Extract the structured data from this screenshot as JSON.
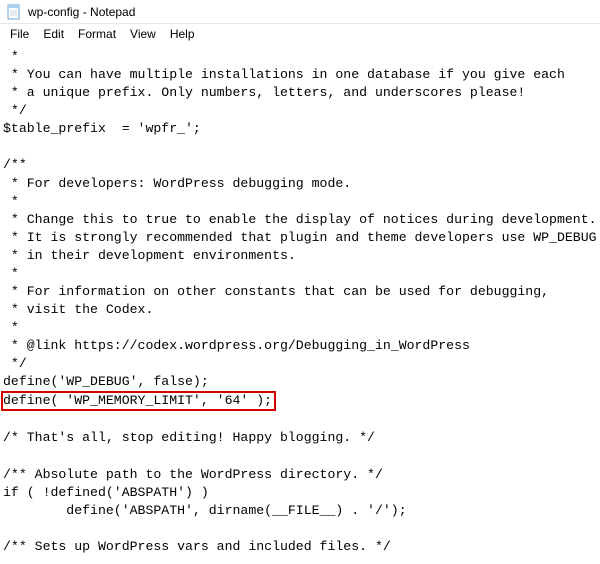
{
  "titlebar": {
    "title": "wp-config - Notepad"
  },
  "menubar": {
    "file": "File",
    "edit": "Edit",
    "format": "Format",
    "view": "View",
    "help": "Help"
  },
  "code": {
    "l01": " *",
    "l02": " * You can have multiple installations in one database if you give each",
    "l03": " * a unique prefix. Only numbers, letters, and underscores please!",
    "l04": " */",
    "l05": "$table_prefix  = 'wpfr_';",
    "l06": "",
    "l07": "/**",
    "l08": " * For developers: WordPress debugging mode.",
    "l09": " *",
    "l10": " * Change this to true to enable the display of notices during development.",
    "l11": " * It is strongly recommended that plugin and theme developers use WP_DEBUG",
    "l12": " * in their development environments.",
    "l13": " *",
    "l14": " * For information on other constants that can be used for debugging,",
    "l15": " * visit the Codex.",
    "l16": " *",
    "l17": " * @link https://codex.wordpress.org/Debugging_in_WordPress",
    "l18": " */",
    "l19": "define('WP_DEBUG', false);",
    "l20": "define( 'WP_MEMORY_LIMIT', '64' );",
    "l21": "",
    "l22": "/* That's all, stop editing! Happy blogging. */",
    "l23": "",
    "l24": "/** Absolute path to the WordPress directory. */",
    "l25": "if ( !defined('ABSPATH') )",
    "l26": "        define('ABSPATH', dirname(__FILE__) . '/');",
    "l27": "",
    "l28": "/** Sets up WordPress vars and included files. */"
  }
}
